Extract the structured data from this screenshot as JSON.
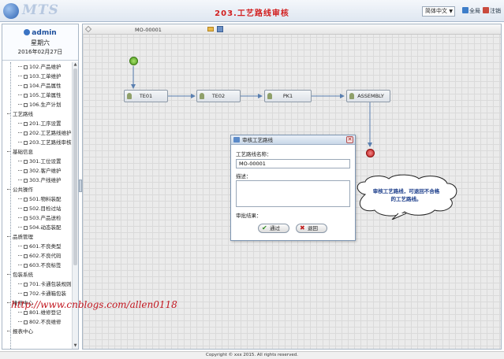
{
  "header": {
    "logo_text": "MTS",
    "title": "203.工艺路线审核",
    "language": "简体中文",
    "fullscreen_label": "全局",
    "logout_label": "注销"
  },
  "user": {
    "name": "admin",
    "weekday": "星期六",
    "date": "2016年02月27日"
  },
  "sidebar": {
    "rows": [
      {
        "type": "leaf",
        "label": "102.产品维护"
      },
      {
        "type": "leaf",
        "label": "103.工单维护"
      },
      {
        "type": "leaf",
        "label": "104.产品属性"
      },
      {
        "type": "leaf",
        "label": "105.工单属性"
      },
      {
        "type": "leaf",
        "label": "106.生产计划"
      },
      {
        "type": "group",
        "label": "工艺路线"
      },
      {
        "type": "leaf",
        "label": "201.工序设置"
      },
      {
        "type": "leaf",
        "label": "202.工艺路线维护"
      },
      {
        "type": "leaf",
        "label": "203.工艺路线审核"
      },
      {
        "type": "group",
        "label": "基础信息"
      },
      {
        "type": "leaf",
        "label": "301.工位设置"
      },
      {
        "type": "leaf",
        "label": "302.客户维护"
      },
      {
        "type": "leaf",
        "label": "303.产线维护"
      },
      {
        "type": "group",
        "label": "公共操作"
      },
      {
        "type": "leaf",
        "label": "501.物料装配"
      },
      {
        "type": "leaf",
        "label": "502.目检过站"
      },
      {
        "type": "leaf",
        "label": "503.产品送检"
      },
      {
        "type": "leaf",
        "label": "504.动态装配"
      },
      {
        "type": "group",
        "label": "品质管理"
      },
      {
        "type": "leaf",
        "label": "601.不良类型"
      },
      {
        "type": "leaf",
        "label": "602.不良代码"
      },
      {
        "type": "leaf",
        "label": "603.不良标签"
      },
      {
        "type": "group",
        "label": "包装系统"
      },
      {
        "type": "leaf",
        "label": "701.卡通包装规则"
      },
      {
        "type": "leaf",
        "label": "702.卡通箱包装"
      },
      {
        "type": "group",
        "label": "维修中心"
      },
      {
        "type": "leaf",
        "label": "801.维修登记"
      },
      {
        "type": "leaf",
        "label": "802.不良维修"
      },
      {
        "type": "group",
        "label": "报表中心"
      }
    ]
  },
  "toolbar": {
    "route_code": "MO-00001"
  },
  "flow": {
    "nodes": [
      {
        "label": "TE01"
      },
      {
        "label": "TE02"
      },
      {
        "label": "PK1"
      },
      {
        "label": "ASSEMBLY"
      }
    ]
  },
  "dialog": {
    "title": "审核工艺路线",
    "close_glyph": "✕",
    "route_name_label": "工艺路线名称：",
    "route_name_value": "MO-00001",
    "description_label": "描述：",
    "result_label": "审批结果：",
    "pass_label": "通过",
    "reject_label": "退回"
  },
  "callout": {
    "line1": "审核工艺路线，可退回不合格",
    "line2": "的工艺路线。"
  },
  "watermark": "http://www.cnblogs.com/allen0118",
  "footer": "Copyright © xxx 2015. All rights reserved.",
  "colors": {
    "title_red": "#d21f1f",
    "accent_blue": "#1d4f9c",
    "start_green": "#4e9a1e",
    "end_red": "#c01818"
  },
  "icons": {
    "pass": "check-icon",
    "reject": "cross-icon"
  }
}
